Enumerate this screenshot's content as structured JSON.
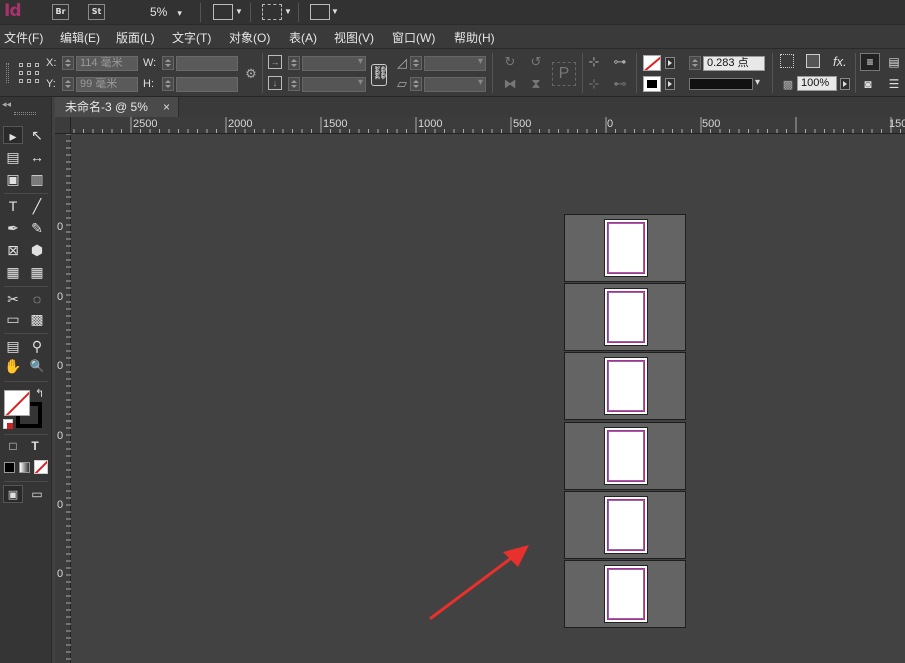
{
  "app": {
    "logo": "Id",
    "bridge_badge": "Br",
    "stock_badge": "St",
    "zoom": "5%",
    "zoom_arrow": "▾"
  },
  "menu": [
    "文件(F)",
    "编辑(E)",
    "版面(L)",
    "文字(T)",
    "对象(O)",
    "表(A)",
    "视图(V)",
    "窗口(W)",
    "帮助(H)"
  ],
  "control": {
    "x_label": "X:",
    "x_value": "114 毫米",
    "y_label": "Y:",
    "y_value": "99 毫米",
    "w_label": "W:",
    "w_value": "",
    "h_label": "H:",
    "h_value": "",
    "stroke_weight": "0.283 点",
    "opacity": "100%",
    "fx": "fx."
  },
  "document": {
    "tab_title": "未命名-3 @ 5%",
    "tab_close": "×"
  },
  "ruler": {
    "h_labels": [
      "2500",
      "2000",
      "1500",
      "1000",
      "500",
      "0",
      "500",
      "150"
    ],
    "v_labels": [
      "0",
      "0",
      "0",
      "0",
      "0",
      "0"
    ]
  },
  "toolbox": {
    "collapse": "◂◂",
    "tools": [
      "▸",
      "↖",
      "▤",
      "↔",
      "▣",
      "▥",
      "T",
      "╱",
      "✒",
      "✎",
      "⊠",
      "⬢",
      "▦",
      "▦",
      "✂",
      "◌",
      "▭",
      "▩",
      "▤",
      "⚲",
      "✋",
      "🔍"
    ],
    "swap": "↰",
    "format_box": "□",
    "format_text": "T"
  },
  "spreads": {
    "count": 6
  },
  "colors": {
    "accent_logo": "#a8326b",
    "margin_magenta": "#c22a6a",
    "margin_violet": "#7e6ac8",
    "arrow_red": "#e8302c"
  }
}
